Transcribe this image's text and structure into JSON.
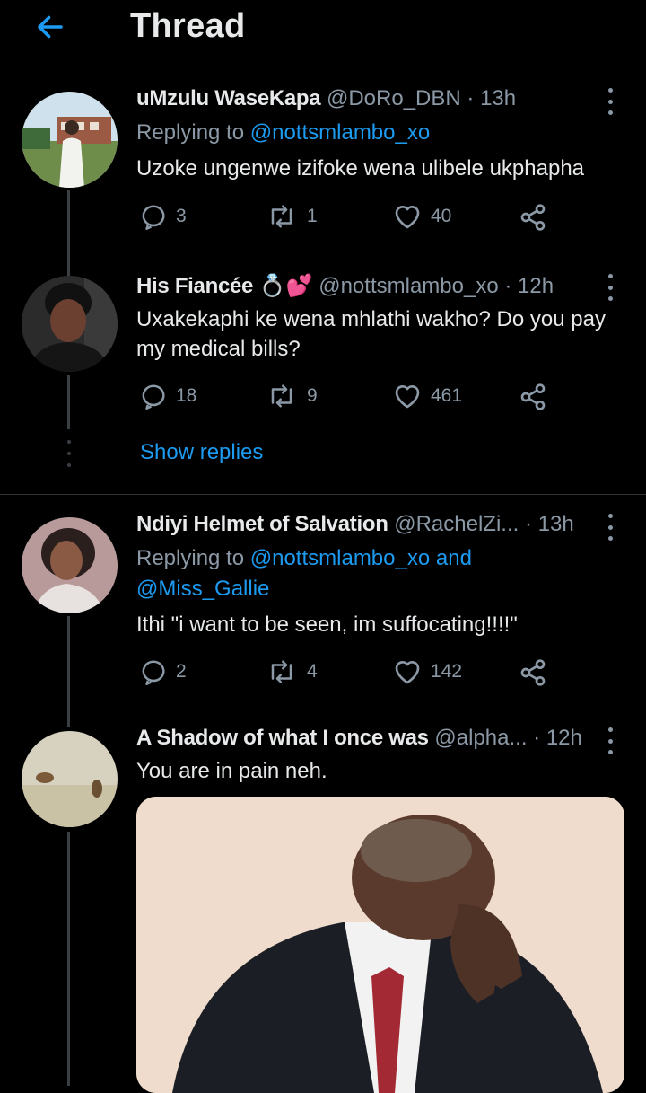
{
  "header": {
    "title": "Thread",
    "back_icon": "arrow-left-icon",
    "accent": "#1d9bf0"
  },
  "tweets": [
    {
      "name": "uMzulu WaseKapa",
      "handle": "@DoRo_DBN",
      "time": "· 13h",
      "reply_prefix": "Replying to",
      "reply_to": "@nottsmlambo_xo",
      "text": "Uzoke ungenwe izifoke wena ulibele ukphapha",
      "replies": "3",
      "retweets": "1",
      "likes": "40"
    },
    {
      "name": "His Fiancée",
      "name_emoji": "💍💕",
      "handle": "@nottsmlambo_xo",
      "time": "· 12h",
      "text": "Uxakekaphi ke wena mhlathi wakho? Do you pay my medical bills?",
      "replies": "18",
      "retweets": "9",
      "likes": "461",
      "show_replies": "Show replies"
    },
    {
      "name": "Ndiyi Helmet of Salvation",
      "handle": "@RachelZi...",
      "time": "· 13h",
      "reply_prefix": "Replying to",
      "reply_to": "@nottsmlambo_xo and",
      "reply_to_2": "@Miss_Gallie",
      "text": "Ithi \"i want to be seen, im suffocating!!!!\"",
      "replies": "2",
      "retweets": "4",
      "likes": "142"
    },
    {
      "name": "A Shadow of what I once was",
      "handle": "@alpha...",
      "time": "· 12h",
      "text": "You are in pain neh."
    }
  ]
}
